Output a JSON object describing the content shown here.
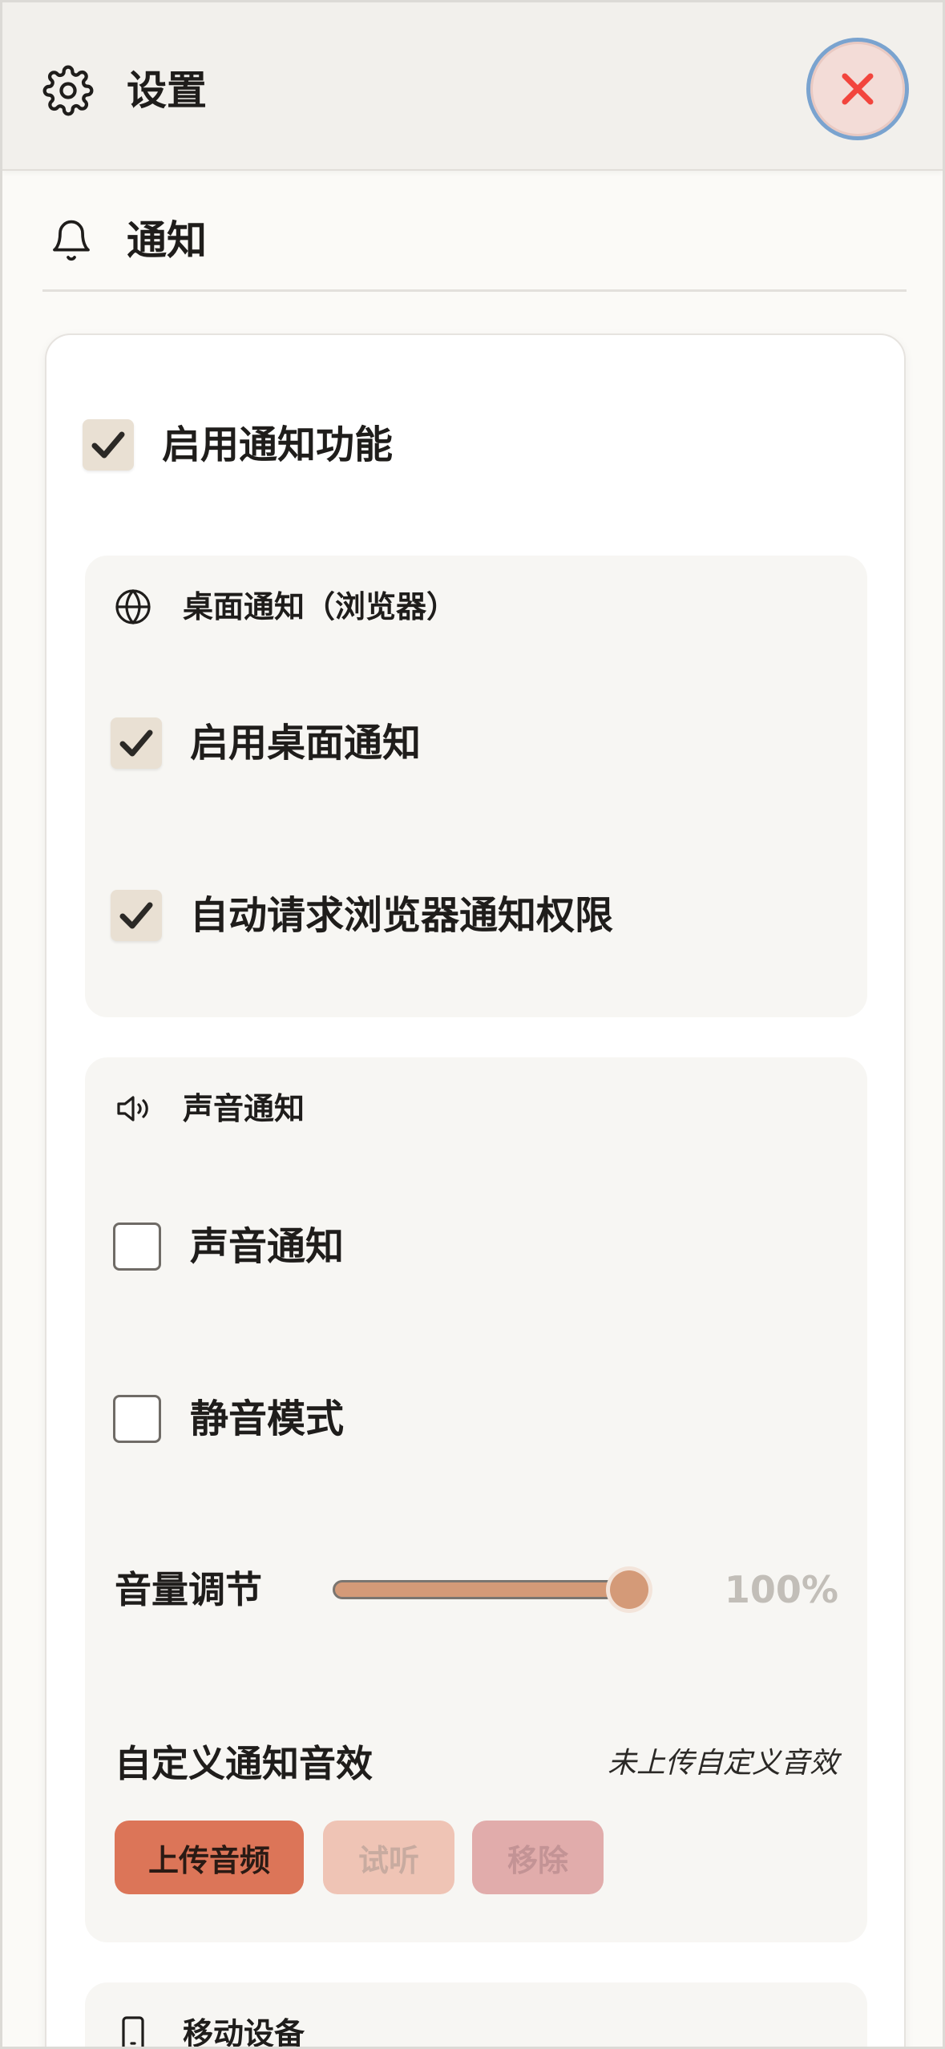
{
  "header": {
    "title": "设置",
    "icon": "gear-icon",
    "close_icon": "close-icon",
    "close_color": "#f2453d"
  },
  "section": {
    "title": "通知",
    "icon": "bell-icon"
  },
  "notifications": {
    "enable_label": "启用通知功能",
    "enable_checked": true,
    "desktop": {
      "heading": "桌面通知（浏览器）",
      "icon": "globe-icon",
      "options": [
        {
          "label": "启用桌面通知",
          "checked": true
        },
        {
          "label": "自动请求浏览器通知权限",
          "checked": true
        }
      ]
    },
    "sound": {
      "heading": "声音通知",
      "icon": "speaker-icon",
      "options": [
        {
          "label": "声音通知",
          "checked": false
        },
        {
          "label": "静音模式",
          "checked": false
        }
      ],
      "volume_label": "音量调节",
      "volume_value": "100%",
      "volume_fraction": 1.0,
      "custom_label": "自定义通知音效",
      "custom_status": "未上传自定义音效",
      "buttons": {
        "upload": "上传音频",
        "preview": "试听",
        "remove": "移除"
      }
    },
    "mobile": {
      "heading": "移动设备",
      "icon": "phone-icon"
    }
  },
  "colors": {
    "accent": "#dc7558",
    "checkbox_bg": "#e9e0d3",
    "panel_bg": "#f7f6f3"
  }
}
